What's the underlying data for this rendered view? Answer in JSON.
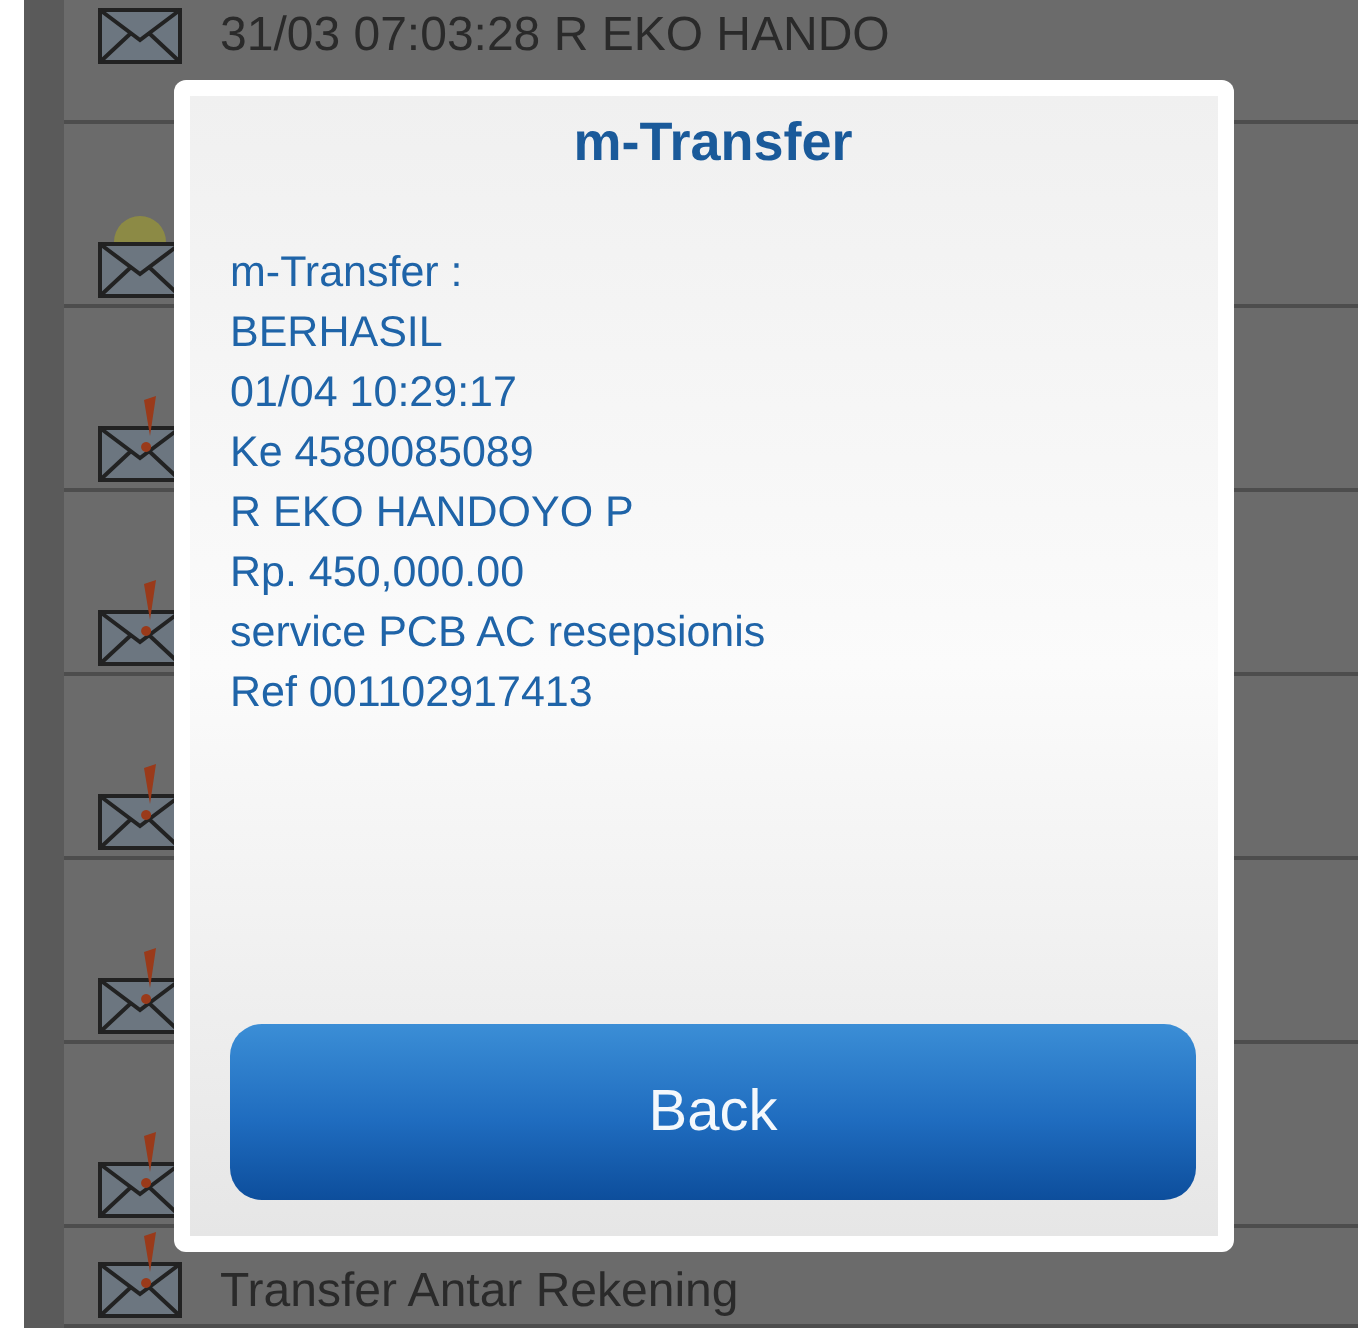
{
  "messages": [
    {
      "kind": "plain",
      "text": "31/03 07:03:28 R EKO HANDO"
    },
    {
      "kind": "seal"
    },
    {
      "kind": "alert"
    },
    {
      "kind": "alert"
    },
    {
      "kind": "alert"
    },
    {
      "kind": "alert"
    },
    {
      "kind": "alert"
    },
    {
      "kind": "alert",
      "text": "Transfer Antar Rekening"
    }
  ],
  "dialog": {
    "title": "m-Transfer",
    "lines": [
      "m-Transfer :",
      "BERHASIL",
      "01/04 10:29:17",
      "Ke 4580085089",
      "R EKO HANDOYO P",
      "Rp. 450,000.00",
      "service PCB AC resepsionis",
      "Ref 001102917413"
    ],
    "button": "Back"
  }
}
